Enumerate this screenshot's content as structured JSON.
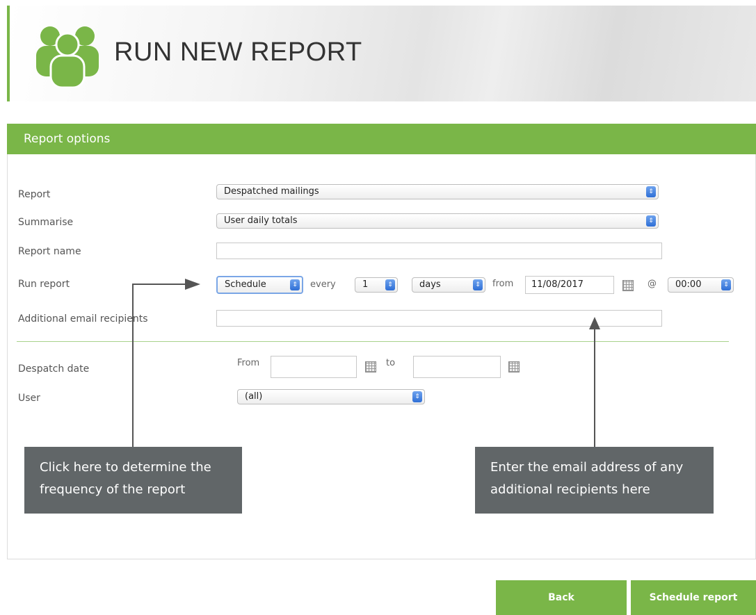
{
  "header": {
    "title": "RUN NEW REPORT",
    "icon": "users-group-icon"
  },
  "panel": {
    "title": "Report options"
  },
  "fields": {
    "report": {
      "label": "Report",
      "value": "Despatched mailings"
    },
    "summarise": {
      "label": "Summarise",
      "value": "User daily totals"
    },
    "report_name": {
      "label": "Report name",
      "value": ""
    },
    "run_report": {
      "label": "Run report",
      "mode": "Schedule",
      "every_label": "every",
      "interval": "1",
      "unit": "days",
      "from_label": "from",
      "start_date": "11/08/2017",
      "at_label": "@",
      "time": "00:00"
    },
    "additional_email": {
      "label": "Additional email recipients",
      "value": ""
    },
    "despatch_date": {
      "label": "Despatch date",
      "from_label": "From",
      "to_label": "to",
      "from_value": "",
      "to_value": ""
    },
    "user": {
      "label": "User",
      "value": "(all)"
    }
  },
  "callouts": {
    "left": "Click here to determine the frequency of the report",
    "right": "Enter the email address of any additional recipients here"
  },
  "buttons": {
    "back": "Back",
    "schedule": "Schedule report"
  },
  "colors": {
    "accent": "#7ab648",
    "callout": "#616668"
  }
}
